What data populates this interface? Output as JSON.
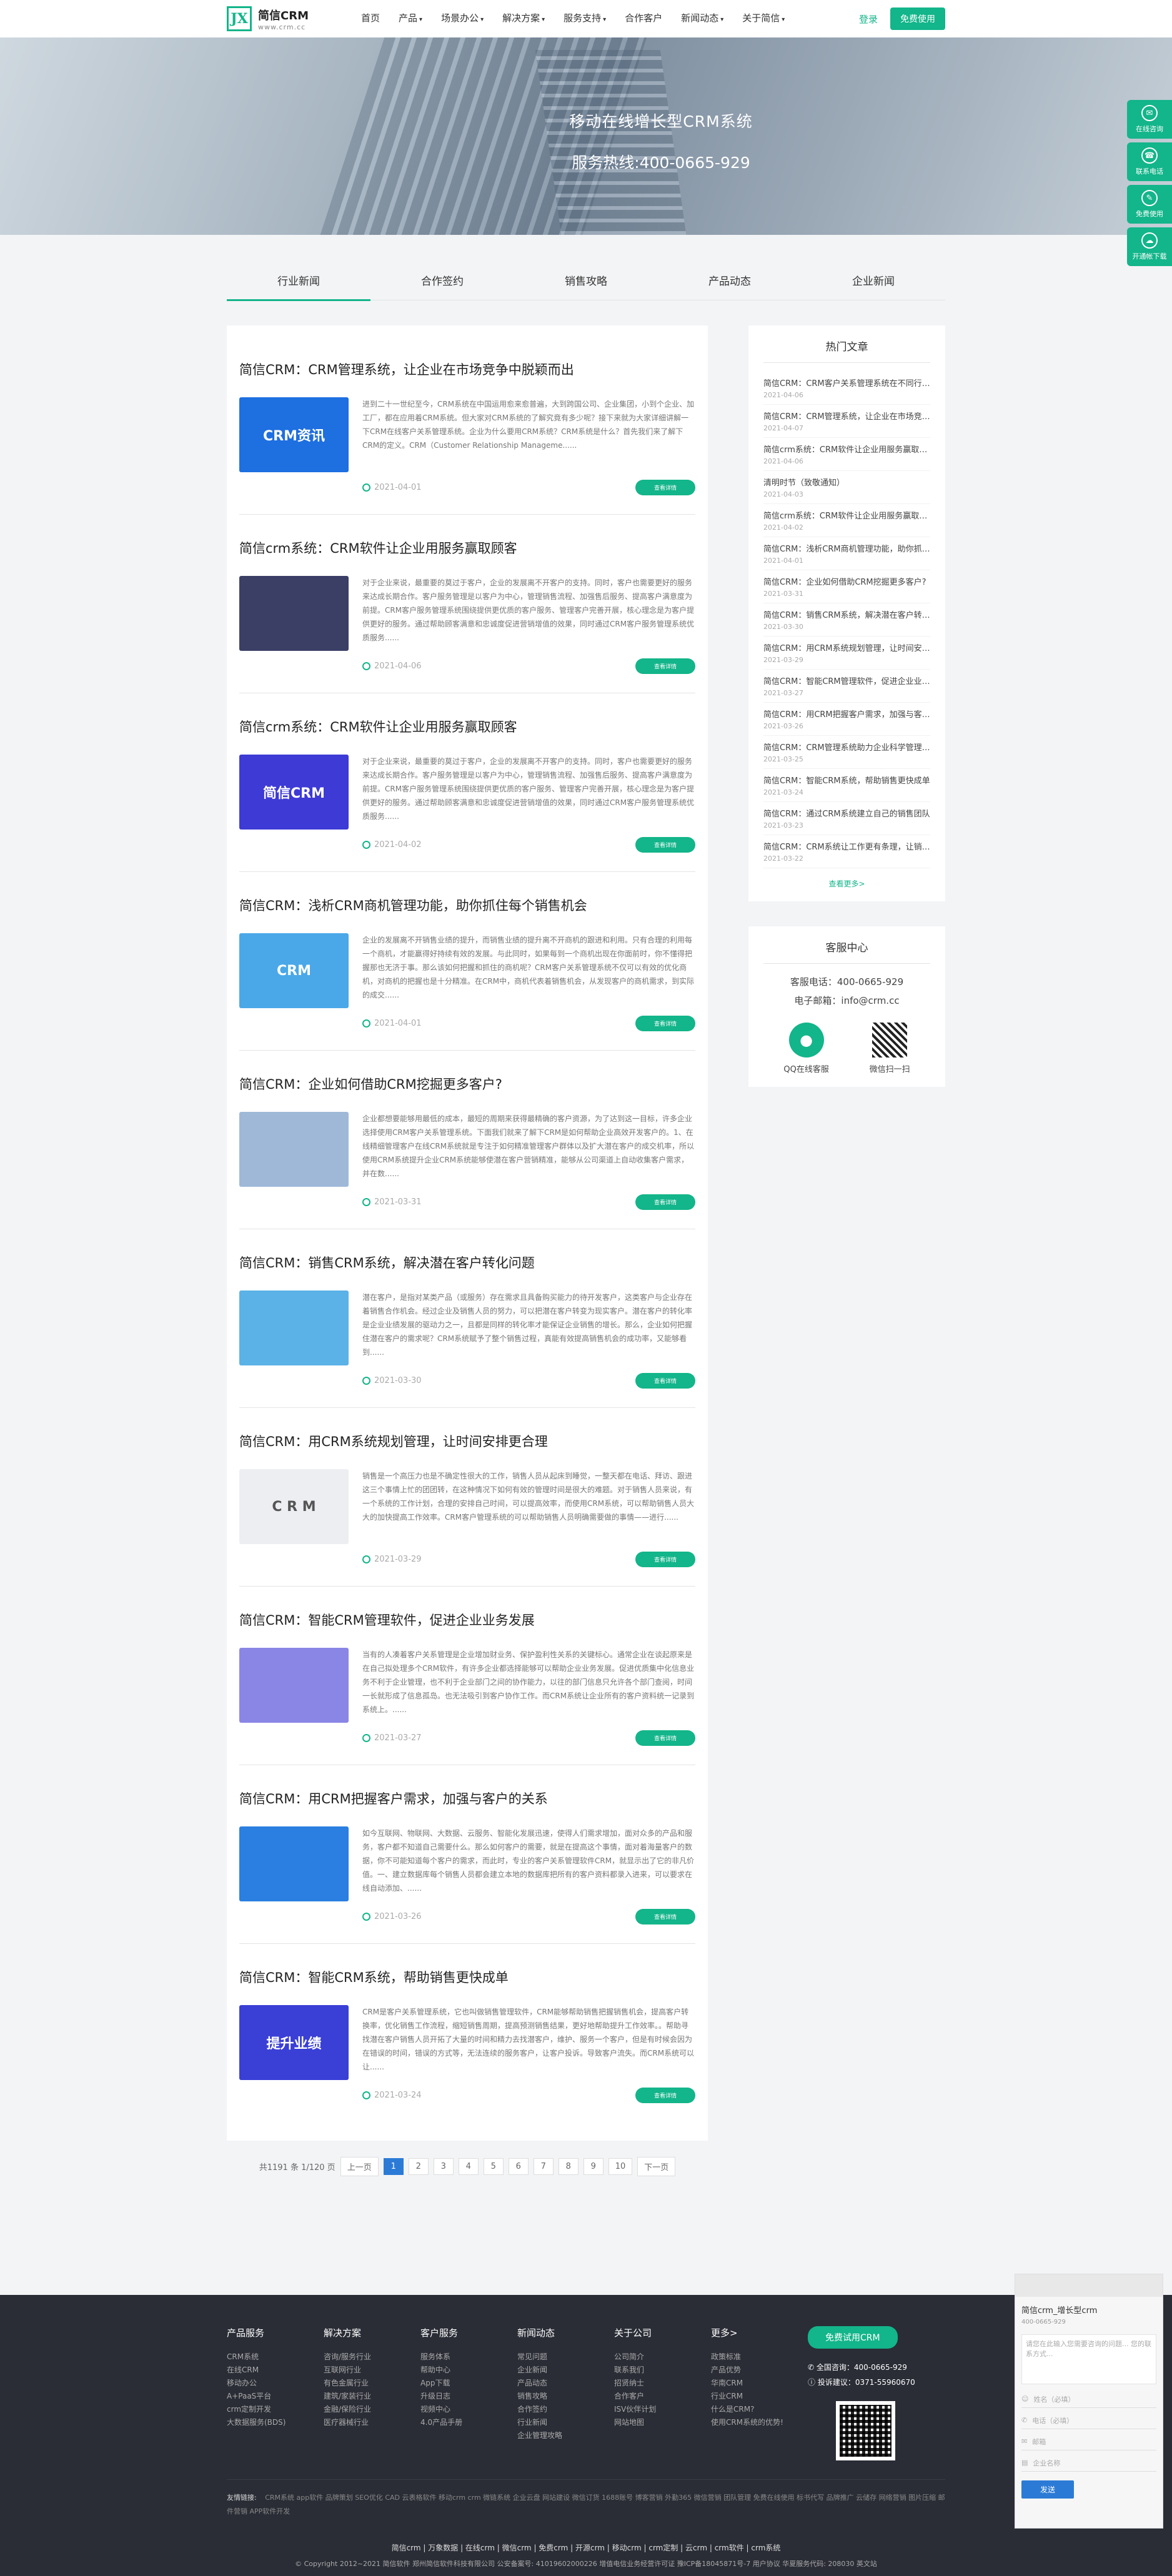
{
  "header": {
    "logo_mark": "JX",
    "logo_name": "简信CRM",
    "logo_url": "www.crm.cc",
    "nav": [
      {
        "label": "首页",
        "caret": false
      },
      {
        "label": "产品",
        "caret": true
      },
      {
        "label": "场景办公",
        "caret": true
      },
      {
        "label": "解决方案",
        "caret": true
      },
      {
        "label": "服务支持",
        "caret": true
      },
      {
        "label": "合作客户",
        "caret": false
      },
      {
        "label": "新闻动态",
        "caret": true
      },
      {
        "label": "关于简信",
        "caret": true
      }
    ],
    "login": "登录",
    "free_trial": "免费使用"
  },
  "banner": {
    "line1": "移动在线增长型CRM系统",
    "line2": "服务热线:400-0665-929"
  },
  "side_float": [
    {
      "label": "在线咨询",
      "icon": "chat-icon"
    },
    {
      "label": "联系电话",
      "icon": "phone-icon"
    },
    {
      "label": "免费使用",
      "icon": "edit-icon"
    },
    {
      "label": "开通帐下载",
      "icon": "cloud-icon"
    }
  ],
  "tabs": [
    "行业新闻",
    "合作签约",
    "销售攻略",
    "产品动态",
    "企业新闻"
  ],
  "articles": [
    {
      "title": "简信CRM：CRM管理系统，让企业在市场竞争中脱颖而出",
      "excerpt": "进到二十一世纪至今，CRM系统在中国运用愈来愈普遍，大到跨国公司、企业集团，小到个企业、加工厂，都在应用着CRM系统。但大家对CRM系统的了解究竟有多少呢？接下来就为大家详细讲解一下CRM在线客户关系管理系统。企业为什么要用CRM系统？CRM系统是什么？首先我们来了解下CRM的定义。CRM（Customer Relationship Manageme......",
      "date": "2021-04-01",
      "more": "查看详情",
      "thumb_text": "CRM资讯",
      "thumb_color": "#1e6fe0"
    },
    {
      "title": "简信crm系统：CRM软件让企业用服务赢取顾客",
      "excerpt": "对于企业来说，最重要的莫过于客户，企业的发展离不开客户的支持。同时，客户也需要更好的服务来达成长期合作。客户服务管理是以客户为中心，管理销售流程、加强售后服务、提高客户满意度为前提。CRM客户服务管理系统围绕提供更优质的客户服务、管理客户完善开展，核心理念是为客户提供更好的服务。通过帮助顾客满意和忠诚度促进营销增值的效果，同时通过CRM客户服务管理系统优质服务......",
      "date": "2021-04-06",
      "more": "查看详情",
      "thumb_text": "",
      "thumb_color": "#3b3f66"
    },
    {
      "title": "简信crm系统：CRM软件让企业用服务赢取顾客",
      "excerpt": "对于企业来说，最重要的莫过于客户，企业的发展离不开客户的支持。同时，客户也需要更好的服务来达成长期合作。客户服务管理是以客户为中心，管理销售流程、加强售后服务、提高客户满意度为前提。CRM客户服务管理系统围绕提供更优质的客户服务、管理客户完善开展，核心理念是为客户提供更好的服务。通过帮助顾客满意和忠诚度促进营销增值的效果，同时通过CRM客户服务管理系统优质服务......",
      "date": "2021-04-02",
      "more": "查看详情",
      "thumb_text": "简信CRM",
      "thumb_color": "#3d3ad6"
    },
    {
      "title": "简信CRM：浅析CRM商机管理功能，助你抓住每个销售机会",
      "excerpt": "企业的发展离不开销售业绩的提升，而销售业绩的提升离不开商机的跟进和利用。只有合理的利用每一个商机，才能赢得好持续有效的发展。与此同时，如果每到一个商机出现在你面前时，你不懂得把握那也无济于事。那么该如何把握和抓住的商机呢？CRM客户关系管理系统不仅可以有效的优化商机，对商机的把握也是十分精准。在CRM中，商机代表着销售机会，从发现客户的商机需求，到实际的成交......",
      "date": "2021-04-01",
      "more": "查看详情",
      "thumb_text": "CRM",
      "thumb_color": "#4aa8e8"
    },
    {
      "title": "简信CRM：企业如何借助CRM挖掘更多客户?",
      "excerpt": "企业都想要能够用最低的成本，最短的周期来获得最精确的客户资源，为了达到这一目标，许多企业选择使用CRM客户关系管理系统。下面我们就来了解下CRM是如何帮助企业高效开发客户的。1、在线精细管理客户在线CRM系统就是专注于如何精准管理客户群体以及扩大潜在客户的成交机率，所以使用CRM系统提升企业CRM系统能够使潜在客户营销精准，能够从公司渠道上自动收集客户需求，并在数......",
      "date": "2021-03-31",
      "more": "查看详情",
      "thumb_text": "",
      "thumb_color": "#9fb8d8"
    },
    {
      "title": "简信CRM：销售CRM系统，解决潜在客户转化问题",
      "excerpt": "潜在客户，是指对某类产品（或服务）存在需求且具备购买能力的待开发客户，这类客户与企业存在着销售合作机会。经过企业及销售人员的努力，可以把潜在客户转变为现实客户。潜在客户的转化率是企业业绩发展的驱动力之一，且都是同样的转化率才能保证企业销售的增长。那么，企业如何把握住潜在客户的需求呢？CRM系统赋予了整个销售过程，真能有效提高销售机会的成功率，又能够看到......",
      "date": "2021-03-30",
      "more": "查看详情",
      "thumb_text": "",
      "thumb_color": "#5ab2e6"
    },
    {
      "title": "简信CRM：用CRM系统规划管理，让时间安排更合理",
      "excerpt": "销售是一个高压力也是不确定性很大的工作，销售人员从起床到睡觉，一整天都在电话、拜访、跟进这三个事情上忙的团团转，在这种情况下如何有效的管理时间是很大的难题。对于销售人员来说，有一个系统的工作计划，合理的安排自己时间，可以提高效率，而使用CRM系统，可以帮助销售人员大大的加快提高工作效率。CRM客户管理系统的可以帮助销售人员明确需要做的事情——进行......",
      "date": "2021-03-29",
      "more": "查看详情",
      "thumb_text": "C R M",
      "thumb_color": "#eceef2"
    },
    {
      "title": "简信CRM：智能CRM管理软件，促进企业业务发展",
      "excerpt": "当有的人凑着客户关系管理是企业增加财业务、保护盈利性关系的关键标心。通常企业在谈起原来是在自己拟处理多个CRM软件，有许多企业都选择能够可以帮助企业业务发展。促进优质集中化信息业务不利于企业管理，也不利于企业部门之间的协作能力，以往的部门信息只允许各个部门查阅，时间一长就形成了信息孤岛。也无法吸引到客户协作工作。而CRM系统让企业所有的客户资料统一记录到系统上。......",
      "date": "2021-03-27",
      "more": "查看详情",
      "thumb_text": "",
      "thumb_color": "#8a86e6"
    },
    {
      "title": "简信CRM：用CRM把握客户需求，加强与客户的关系",
      "excerpt": "如今互联网、物联网、大数据、云服务、智能化发展迅速，使得人们需求增加，面对众多的产品和服务，客户都不知道自己需要什么。那么如何客户的需要，就是在提高这个事情，面对着海量客户的数据，你不可能知道每个客户的需求，而此时，专业的客户关系管理软件CRM，就显示出了它的非凡价值。一、建立数据库每个销售人员都会建立本地的数据库把所有的客户资料都录入进来，可以要求在线自动添加、......",
      "date": "2021-03-26",
      "more": "查看详情",
      "thumb_text": "",
      "thumb_color": "#2a7fe0"
    },
    {
      "title": "简信CRM：智能CRM系统，帮助销售更快成单",
      "excerpt": "CRM是客户关系管理系统，它也叫做销售管理软件，CRM能够帮助销售把握销售机会，提高客户转换率，优化销售工作流程，缩短销售周期，提高预测销售结果，更好地帮助提升工作效率。。帮助寻找潜在客户销售人员开拓了大量的时间和精力去找潜客户，维护、服务一个客户，但是有时候会因为在错误的时间，错误的方式等，无法连续的服务客户，让客户投诉。导致客户流失。而CRM系统可以让......",
      "date": "2021-03-24",
      "more": "查看详情",
      "thumb_text": "提升业绩",
      "thumb_color": "#3a3fd6"
    }
  ],
  "pagination": {
    "summary": "共1191 条 1/120 页",
    "prev": "上一页",
    "pages": [
      "1",
      "2",
      "3",
      "4",
      "5",
      "6",
      "7",
      "8",
      "9",
      "10"
    ],
    "next": "下一页"
  },
  "hot": {
    "title": "热门文章",
    "items": [
      {
        "t": "简信CRM：CRM客户关系管理系统在不同行业中的应用",
        "d": "2021-04-06"
      },
      {
        "t": "简信CRM：CRM管理系统，让企业在市场竞争中脱颖而出",
        "d": "2021-04-07"
      },
      {
        "t": "简信crm系统：CRM软件让企业用服务赢取顾客",
        "d": "2021-04-06"
      },
      {
        "t": "清明时节（致敬通知）",
        "d": "2021-04-03"
      },
      {
        "t": "简信crm系统：CRM软件让企业用服务赢取顾客",
        "d": "2021-04-02"
      },
      {
        "t": "简信CRM：浅析CRM商机管理功能，助你抓住每个销售机会",
        "d": "2021-04-01"
      },
      {
        "t": "简信CRM：企业如何借助CRM挖掘更多客户?",
        "d": "2021-03-31"
      },
      {
        "t": "简信CRM：销售CRM系统，解决潜在客户转化问题",
        "d": "2021-03-30"
      },
      {
        "t": "简信CRM：用CRM系统规划管理，让时间安排更合理",
        "d": "2021-03-29"
      },
      {
        "t": "简信CRM：智能CRM管理软件，促进企业业务发展",
        "d": "2021-03-27"
      },
      {
        "t": "简信CRM：用CRM把握客户需求，加强与客户的关系",
        "d": "2021-03-26"
      },
      {
        "t": "简信CRM：CRM管理系统助力企业科学管理客户",
        "d": "2021-03-25"
      },
      {
        "t": "简信CRM：智能CRM系统，帮助销售更快成单",
        "d": "2021-03-24"
      },
      {
        "t": "简信CRM：通过CRM系统建立自己的销售团队",
        "d": "2021-03-23"
      },
      {
        "t": "简信CRM：CRM系统让工作更有条理，让销售更高效",
        "d": "2021-03-22"
      }
    ],
    "more": "查看更多>"
  },
  "service": {
    "title": "客服中心",
    "phone": "客服电话：400-0665-929",
    "email": "电子邮箱：info@crm.cc",
    "qq": "QQ在线客服",
    "wechat": "微信扫一扫"
  },
  "footer": {
    "cols": [
      {
        "h": "产品服务",
        "items": [
          "CRM系统",
          "在线CRM",
          "移动办公",
          "A+PaaS平台",
          "crm定制开发",
          "大数据服务(BDS)"
        ]
      },
      {
        "h": "解决方案",
        "items": [
          "咨询/服务行业",
          "互联网行业",
          "有色金属行业",
          "建筑/家装行业",
          "金融/保险行业",
          "医疗器械行业"
        ]
      },
      {
        "h": "客户服务",
        "items": [
          "服务体系",
          "帮助中心",
          "App下载",
          "升级日志",
          "视频中心",
          "4.0产品手册"
        ]
      },
      {
        "h": "新闻动态",
        "items": [
          "常见问题",
          "企业新闻",
          "产品动态",
          "销售攻略",
          "合作签约",
          "行业新闻",
          "企业管理攻略"
        ]
      },
      {
        "h": "关于公司",
        "items": [
          "公司简介",
          "联系我们",
          "招贤纳士",
          "合作客户",
          "ISV伙伴计划",
          "网站地图"
        ]
      },
      {
        "h": "更多>",
        "items": [
          "政策标准",
          "产品优势",
          "华南CRM",
          "行业CRM",
          "什么是CRM?",
          "使用CRM系统的优势!"
        ]
      }
    ],
    "trial": "免费试用CRM",
    "contact1": "全国咨询：400-0665-929",
    "contact2": "投诉建议：0371-55960670",
    "links_label": "友情链接:",
    "links": "CRM系统   app软件   品牌策划   SEO优化   CAD   云表格软件   移动crm   crm   微链系统   企业云盘   网站建设   微信订货   1688账号   博客营销   外勤365   微信营销   团队管理   免费在线使用   标书代写   品牌推广   云储存   网络营销   图片压缩   邮件营销   APP软件开发",
    "keywords": "简信crm | 万象数据 | 在线crm | 微信crm | 免费crm | 开源crm | 移动crm | crm定制 | 云crm | crm软件 | crm系统",
    "copyright": "© Copyright 2012~2021 简信软件 郑州简信软件科技有限公司  公安备案号: 41019602000226  增值电信业务经营许可证  豫ICP备18045871号-7  用户协议  华夏服务代码: 208030 英文站"
  },
  "chat": {
    "message": "简信crm_增长型crm",
    "sub": "400-0665-929",
    "input_placeholder": "请您在此输入您需要咨询的问题... 您的联系方式...",
    "name": "姓名（必填）",
    "phone": "电话（必填）",
    "email": "邮箱",
    "company": "企业名称",
    "send": "发送"
  }
}
